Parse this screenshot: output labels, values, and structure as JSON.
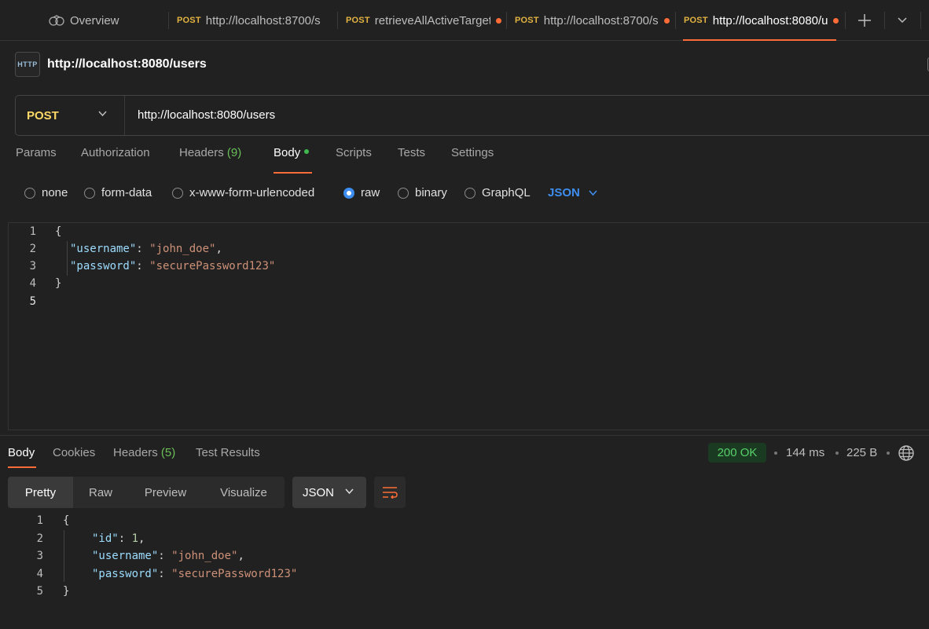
{
  "tabs": {
    "overview_label": "Overview",
    "items": [
      {
        "method": "POST",
        "label": "http://localhost:8700/s",
        "unsaved": false
      },
      {
        "method": "POST",
        "label": "retrieveAllActiveTarget",
        "unsaved": true
      },
      {
        "method": "POST",
        "label": "http://localhost:8700/s",
        "unsaved": true
      },
      {
        "method": "POST",
        "label": "http://localhost:8080/u",
        "unsaved": true
      }
    ],
    "new_tab_icon": "plus-icon",
    "dropdown_icon": "chevron-down-icon"
  },
  "request": {
    "title": "http://localhost:8080/users",
    "icon_text": "HTTP",
    "method": "POST",
    "url": "http://localhost:8080/users"
  },
  "request_tabs": {
    "params": "Params",
    "authorization": "Authorization",
    "headers": "Headers",
    "headers_count": "(9)",
    "body": "Body",
    "scripts": "Scripts",
    "tests": "Tests",
    "settings": "Settings"
  },
  "body_types": {
    "none": "none",
    "form_data": "form-data",
    "urlencoded": "x-www-form-urlencoded",
    "raw": "raw",
    "binary": "binary",
    "graphql": "GraphQL",
    "selected": "raw",
    "language": "JSON"
  },
  "request_body": {
    "line_numbers": [
      "1",
      "2",
      "3",
      "4",
      "5"
    ],
    "open_brace": "{",
    "close_brace": "}",
    "username_key": "\"username\"",
    "username_value": "\"john_doe\"",
    "password_key": "\"password\"",
    "password_value": "\"securePassword123\""
  },
  "response": {
    "tabs": {
      "body": "Body",
      "cookies": "Cookies",
      "headers": "Headers",
      "headers_count": "(5)",
      "test_results": "Test Results"
    },
    "status": "200 OK",
    "time": "144 ms",
    "size": "225 B",
    "views": {
      "pretty": "Pretty",
      "raw": "Raw",
      "preview": "Preview",
      "visualize": "Visualize"
    },
    "format": "JSON",
    "colors": {
      "status_bg": "#1b3a22",
      "status_text": "#57d06a"
    },
    "body": {
      "line_numbers": [
        "1",
        "2",
        "3",
        "4",
        "5"
      ],
      "open_brace": "{",
      "close_brace": "}",
      "id_key": "\"id\"",
      "id_value": "1",
      "username_key": "\"username\"",
      "username_value": "\"john_doe\"",
      "password_key": "\"password\"",
      "password_value": "\"securePassword123\""
    }
  },
  "colors": {
    "accent": "#ff6c37",
    "method": "#ffd866",
    "link_blue": "#3d8ef0"
  }
}
